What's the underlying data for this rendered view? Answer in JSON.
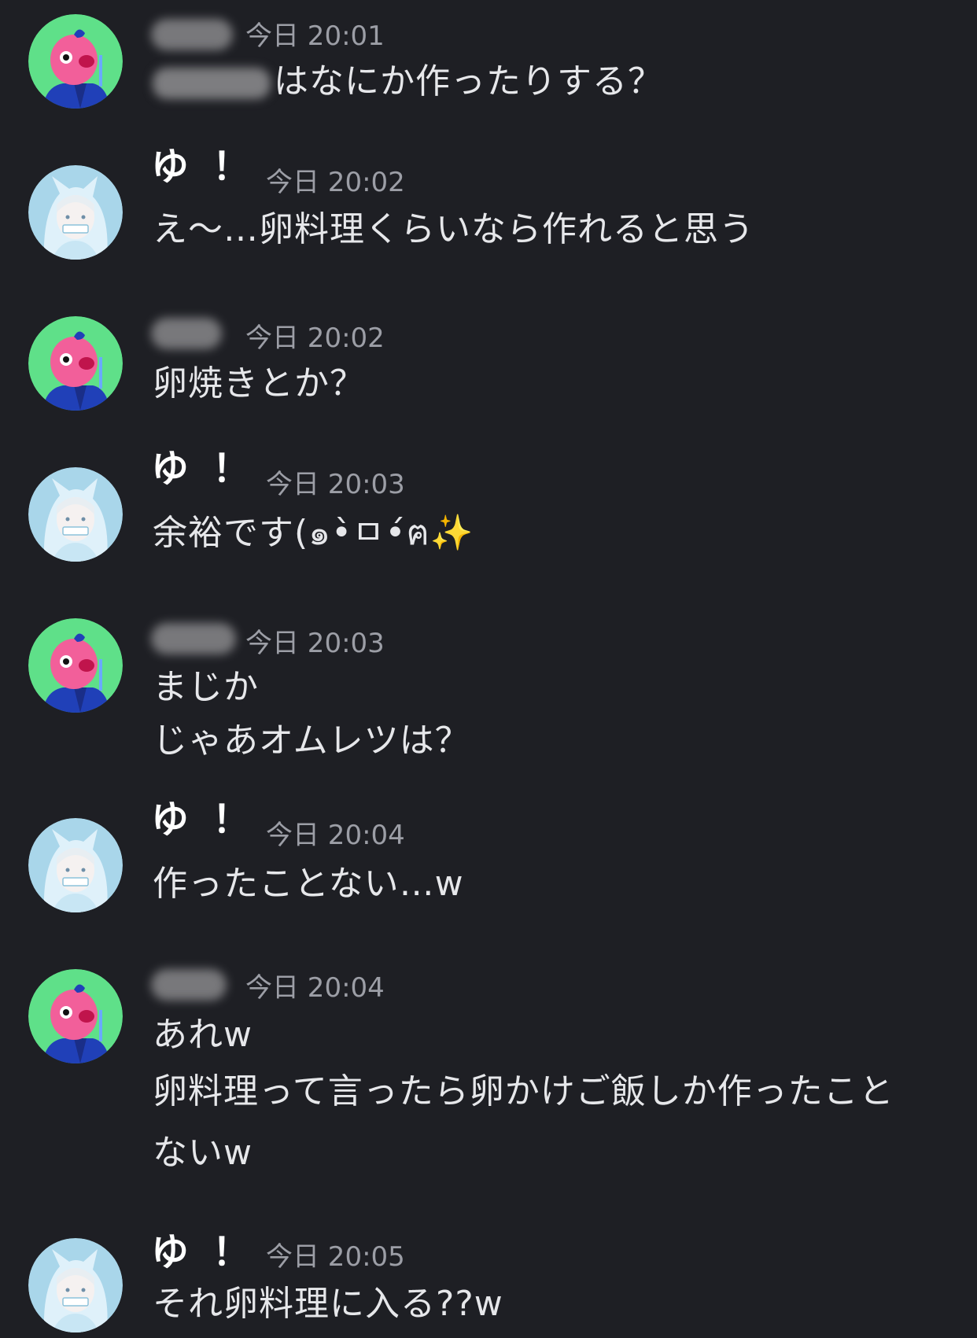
{
  "messages": [
    {
      "author": "redacted",
      "timestamp": "今日 20:01",
      "lines": [
        "はなにか作ったりする？"
      ],
      "first_line_prefix_redacted": true
    },
    {
      "author": "ゆ！",
      "timestamp": "今日 20:02",
      "lines": [
        "え〜…卵料理くらいなら作れると思う"
      ]
    },
    {
      "author": "redacted",
      "timestamp": "今日 20:02",
      "lines": [
        "卵焼きとか？"
      ]
    },
    {
      "author": "ゆ！",
      "timestamp": "今日 20:03",
      "lines": [
        "余裕です(๑•̀ㅁ•́ฅ"
      ],
      "emoji": "✨"
    },
    {
      "author": "redacted",
      "timestamp": "今日 20:03",
      "lines": [
        "まじか",
        "じゃあオムレツは？"
      ]
    },
    {
      "author": "ゆ！",
      "timestamp": "今日 20:04",
      "lines": [
        "作ったことない…w"
      ]
    },
    {
      "author": "redacted",
      "timestamp": "今日 20:04",
      "lines": [
        "あれw",
        "卵料理って言ったら卵かけご飯しか作ったこと",
        "ないw"
      ]
    },
    {
      "author": "ゆ！",
      "timestamp": "今日 20:05",
      "lines": [
        "それ卵料理に入る??w"
      ]
    }
  ],
  "avatars": {
    "redacted": "pink-creature-avatar",
    "ゆ！": "anime-girl-avatar"
  },
  "colors": {
    "background": "#1e1f24",
    "text": "#e6e7ea",
    "timestamp": "#9c9ea6",
    "author_name": "#ffffff",
    "redaction": "#7d7d80"
  }
}
